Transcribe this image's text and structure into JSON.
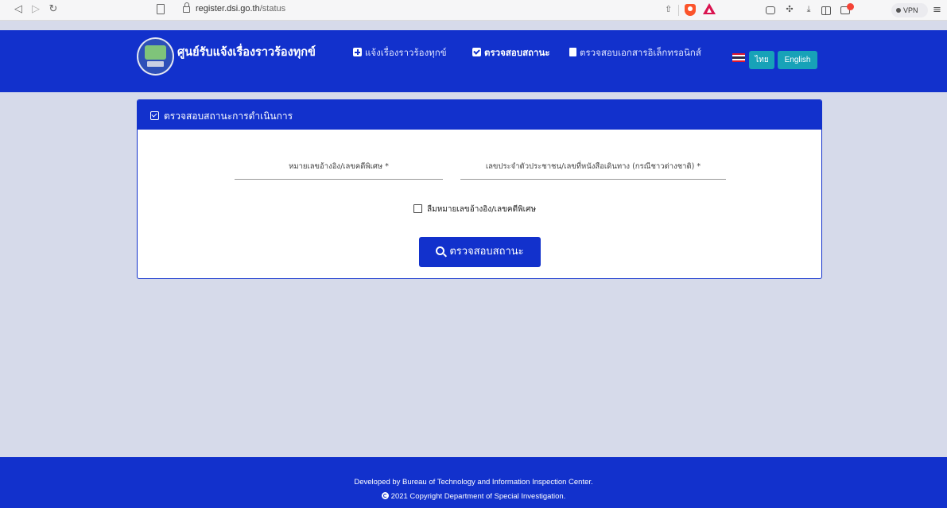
{
  "browser": {
    "url_domain": "register.dsi.go.th",
    "url_path": "/status",
    "vpn_label": "VPN"
  },
  "header": {
    "brand_title": "ศูนย์รับแจ้งเรื่องราวร้องทุกข์",
    "nav": [
      {
        "label": "แจ้งเรื่องราวร้องทุกข์",
        "icon": "plus-square-icon",
        "active": false
      },
      {
        "label": "ตรวจสอบสถานะ",
        "icon": "check-square-icon",
        "active": true
      },
      {
        "label": "ตรวจสอบเอกสารอิเล็กทรอนิกส์",
        "icon": "file-icon",
        "active": false
      }
    ],
    "lang_thai": "ไทย",
    "lang_english": "English"
  },
  "card": {
    "title": "ตรวจสอบสถานะการดำเนินการ",
    "ref_label": "หมายเลขอ้างอิง/เลขคดีพิเศษ *",
    "id_label": "เลขประจำตัวประชาชน/เลขที่หนังสือเดินทาง (กรณีชาวต่างชาติ) *",
    "forgot_label": "ลืมหมายเลขอ้างอิง/เลขคดีพิเศษ",
    "submit_label": "ตรวจสอบสถานะ"
  },
  "footer": {
    "line1": "Developed by Bureau of Technology and Information Inspection Center.",
    "line2": "2021 Copyright Department of Special Investigation."
  },
  "colors": {
    "primary": "#1231cc",
    "background": "#d6daea",
    "lang_button": "#17a2b8"
  }
}
